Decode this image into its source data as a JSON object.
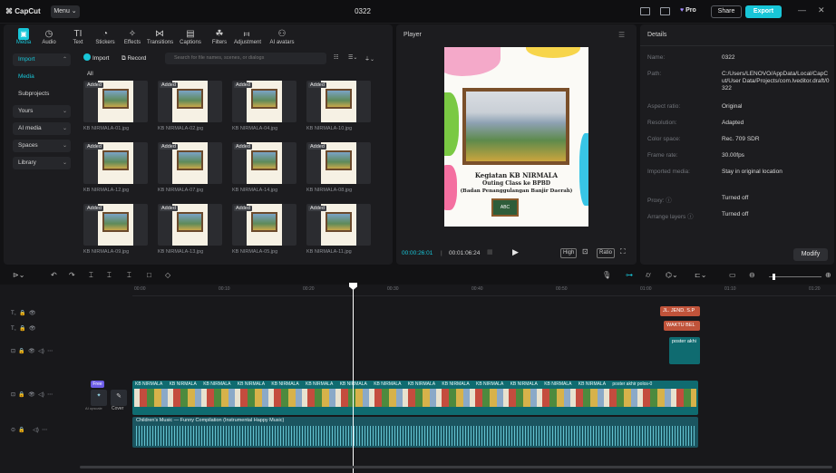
{
  "titlebar": {
    "app": "CapCut",
    "menu": "Menu ⌄",
    "project_title": "0322",
    "pro": "Pro",
    "share": "Share",
    "export": "Export",
    "minimize": "—",
    "close": "✕"
  },
  "tools": [
    {
      "label": "Media",
      "icon": "media-icon",
      "glyph": "▣"
    },
    {
      "label": "Audio",
      "icon": "audio-icon",
      "glyph": "◷"
    },
    {
      "label": "Text",
      "icon": "text-icon",
      "glyph": "TI"
    },
    {
      "label": "Stickers",
      "icon": "stickers-icon",
      "glyph": "◔"
    },
    {
      "label": "Effects",
      "icon": "effects-icon",
      "glyph": "✧"
    },
    {
      "label": "Transitions",
      "icon": "transitions-icon",
      "glyph": "⋈"
    },
    {
      "label": "Captions",
      "icon": "captions-icon",
      "glyph": "▤"
    },
    {
      "label": "Filters",
      "icon": "filters-icon",
      "glyph": "☘"
    },
    {
      "label": "Adjustment",
      "icon": "adjustment-icon",
      "glyph": "⧦"
    },
    {
      "label": "AI avatars",
      "icon": "ai-avatars-icon",
      "glyph": "⚇"
    }
  ],
  "sidebar": {
    "items": [
      {
        "label": "Import",
        "chevron": "⌃"
      },
      {
        "label": "Media"
      },
      {
        "label": "Subprojects"
      },
      {
        "label": "Yours",
        "chevron": "⌄"
      },
      {
        "label": "AI media",
        "chevron": "⌄"
      },
      {
        "label": "Spaces",
        "chevron": "⌄"
      },
      {
        "label": "Library",
        "chevron": "⌄"
      }
    ]
  },
  "media_toolbar": {
    "import": "Import",
    "record": "Record",
    "search_placeholder": "Search for file names, scenes, or dialogs",
    "all": "All"
  },
  "media_items": [
    {
      "name": "KB NIRMALA-01.jpg",
      "badge": "Added"
    },
    {
      "name": "KB NIRMALA-02.jpg",
      "badge": "Added"
    },
    {
      "name": "KB NIRMALA-04.jpg",
      "badge": "Added"
    },
    {
      "name": "KB NIRMALA-10.jpg",
      "badge": "Added"
    },
    {
      "name": "KB NIRMALA-12.jpg",
      "badge": "Added"
    },
    {
      "name": "KB NIRMALA-07.jpg",
      "badge": "Added"
    },
    {
      "name": "KB NIRMALA-14.jpg",
      "badge": "Added"
    },
    {
      "name": "KB NIRMALA-08.jpg",
      "badge": "Added"
    },
    {
      "name": "KB NIRMALA-09.jpg",
      "badge": "Added"
    },
    {
      "name": "KB NIRMALA-13.jpg",
      "badge": "Added"
    },
    {
      "name": "KB NIRMALA-05.jpg",
      "badge": "Added"
    },
    {
      "name": "KB NIRMALA-11.jpg",
      "badge": "Added"
    }
  ],
  "player": {
    "title": "Player",
    "caption1": "Kegiatan KB NIRMALA",
    "caption2": "Outing Class ke BPBD",
    "caption3": "(Badan Penanggulangan Banjir Daerah)",
    "board": "ABC",
    "current_time": "00:00:26:01",
    "total_time": "00:01:06:24",
    "quality": "High",
    "ratio": "Ratio"
  },
  "details": {
    "title": "Details",
    "rows": [
      {
        "key": "Name:",
        "value": "0322"
      },
      {
        "key": "Path:",
        "value": "C:/Users/LENOVO/AppData/Local/CapCut/User Data/Projects/com.lveditor.draft/0322"
      },
      {
        "key": "Aspect ratio:",
        "value": "Original"
      },
      {
        "key": "Resolution:",
        "value": "Adapted"
      },
      {
        "key": "Color space:",
        "value": "Rec. 709 SDR"
      },
      {
        "key": "Frame rate:",
        "value": "30.00fps"
      },
      {
        "key": "Imported media:",
        "value": "Stay in original location"
      },
      {
        "key": "Proxy: ⓘ",
        "value": "Turned off"
      },
      {
        "key": "Arrange layers ⓘ",
        "value": "Turned off"
      }
    ],
    "modify": "Modify"
  },
  "timeline": {
    "ruler": [
      "00:00",
      "00:10",
      "00:20",
      "00:30",
      "00:40",
      "00:50",
      "01:00",
      "01:10",
      "01:20"
    ],
    "text_clips": [
      "JL. JEND. S.P",
      "WAKTU BEL"
    ],
    "overlay_clip": "poster akhi",
    "cover_label": "Cover",
    "free_badge": "Free",
    "ai_label": "AI upscale",
    "main_track_labels": [
      "KB NIRMALA",
      "KB NIRMALA",
      "KB NIRMALA",
      "KB NIRMALA",
      "KB NIRMALA",
      "KB NIRMALA",
      "KB NIRMALA",
      "KB NIRMALA",
      "KB NIRMALA",
      "KB NIRMALA",
      "KB NIRMALA",
      "KB NIRMALA",
      "KB NIRMALA",
      "KB NIRMALA",
      "poster akhir polos-0"
    ],
    "audio_label": "Children's Music — Funny Compilation (Instrumental Happy Music)"
  }
}
